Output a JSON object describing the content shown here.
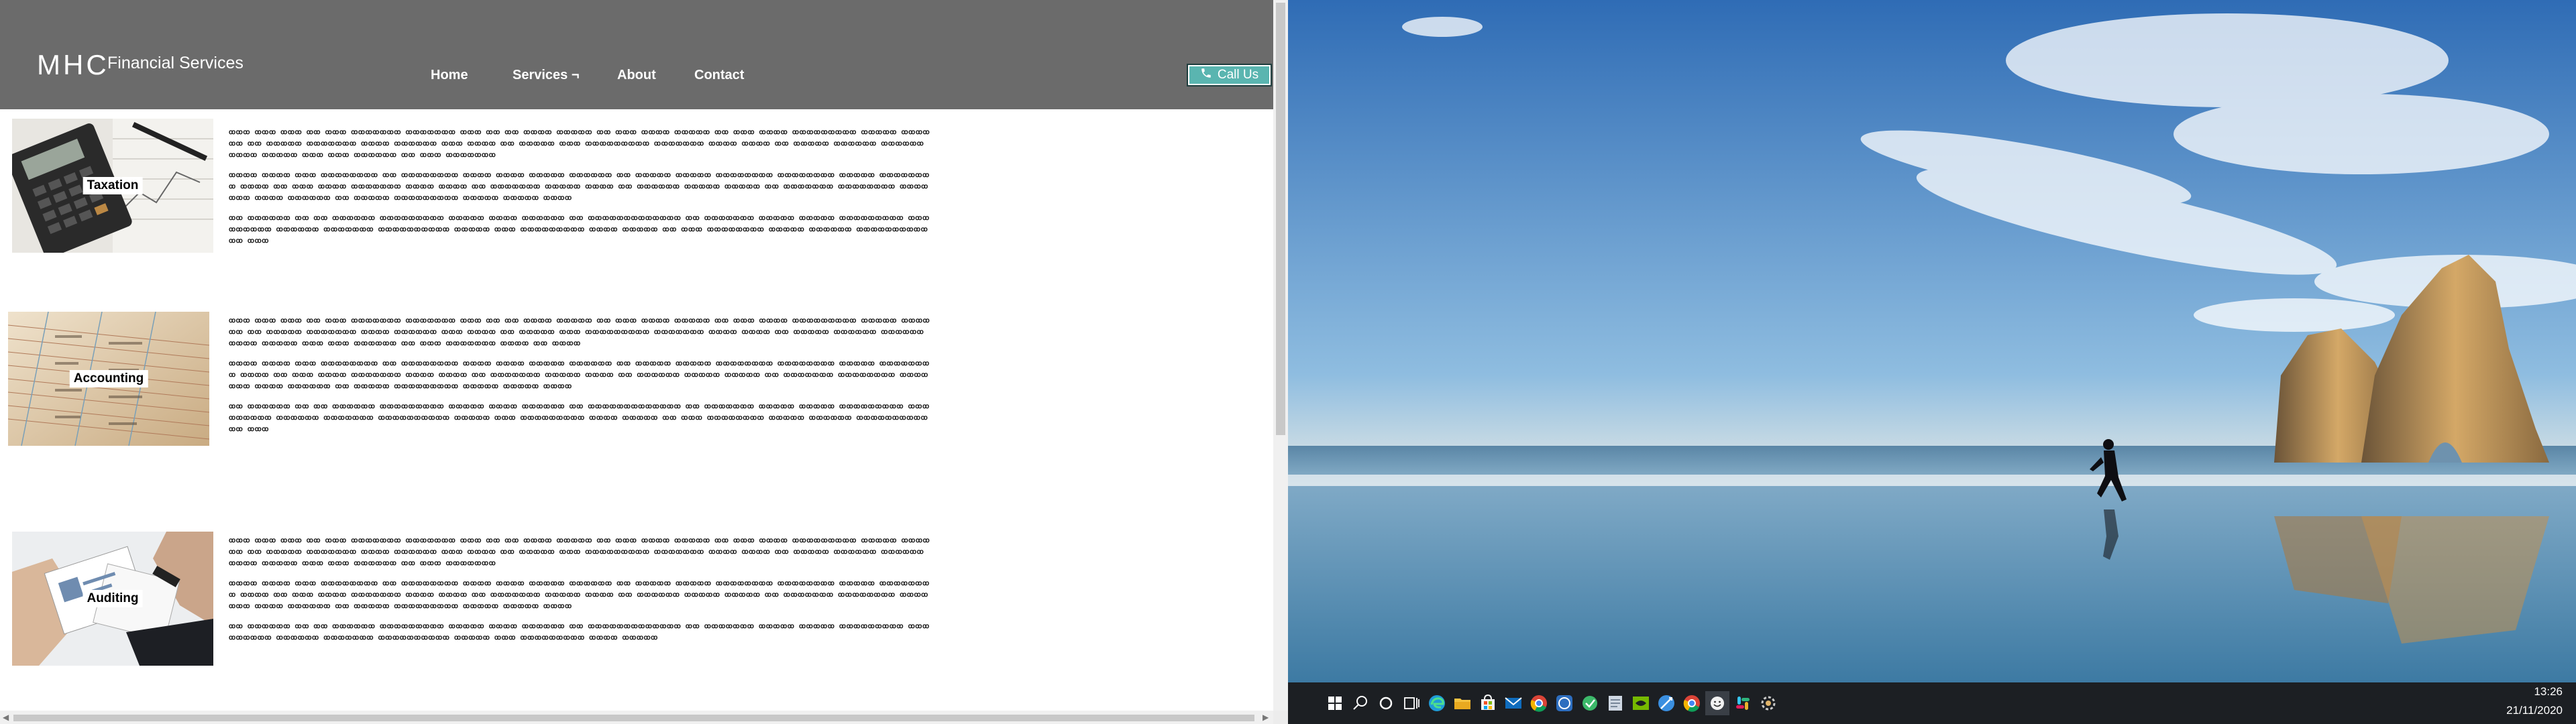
{
  "site": {
    "logo_mhc": "MHC",
    "logo_sub": "Financial Services",
    "nav": [
      "Home",
      "Services ¬",
      "About",
      "Contact"
    ],
    "call_label": "Call Us",
    "header_color": "#6b6b6b",
    "accent_color": "#5ab5b0"
  },
  "services": [
    {
      "label": "Taxation",
      "paragraphs": [
        "ꝏꝏꝏ ꝏꝏꝏ ꝏꝏꝏ ꝏꝏ ꝏꝏꝏ ꝏꝏꝏꝏꝏꝏꝏ ꝏꝏꝏꝏꝏꝏꝏ ꝏꝏꝏ ꝏꝏ ꝏꝏ ꝏꝏꝏꝏ ꝏꝏꝏꝏꝏ ꝏꝏ ꝏꝏꝏ ꝏꝏꝏꝏ ꝏꝏꝏꝏꝏ ꝏꝏ ꝏꝏꝏ ꝏꝏꝏꝏ ꝏꝏꝏꝏꝏꝏꝏꝏꝏ ꝏꝏꝏꝏꝏ ꝏꝏꝏꝏ ꝏꝏ ꝏꝏ ꝏꝏꝏꝏꝏ ꝏꝏꝏꝏꝏꝏꝏ ꝏꝏꝏꝏ ꝏꝏꝏꝏꝏꝏ ꝏꝏꝏ ꝏꝏꝏꝏ ꝏꝏ ꝏꝏꝏꝏꝏ ꝏꝏꝏ ꝏꝏꝏꝏꝏꝏꝏꝏꝏ ꝏꝏꝏꝏꝏꝏꝏ ꝏꝏꝏꝏ ꝏꝏꝏꝏ ꝏꝏ ꝏꝏꝏꝏꝏ ꝏꝏꝏꝏꝏꝏ ꝏꝏꝏꝏꝏꝏ ꝏꝏꝏꝏ ꝏꝏꝏꝏꝏ ꝏꝏꝏ ꝏꝏꝏ ꝏꝏꝏꝏꝏꝏ ꝏꝏ ꝏꝏꝏ ꝏꝏꝏꝏꝏꝏꝏ",
        "ꝏꝏꝏꝏ ꝏꝏꝏꝏ ꝏꝏꝏ ꝏꝏꝏꝏꝏꝏꝏꝏ ꝏꝏ ꝏꝏꝏꝏꝏꝏꝏꝏ ꝏꝏꝏꝏ ꝏꝏꝏꝏ ꝏꝏꝏꝏꝏ ꝏꝏꝏꝏꝏꝏ ꝏꝏ ꝏꝏꝏꝏꝏ ꝏꝏꝏꝏꝏ ꝏꝏꝏꝏꝏꝏꝏꝏ ꝏꝏꝏꝏꝏꝏꝏꝏ ꝏꝏꝏꝏꝏ ꝏꝏꝏꝏꝏꝏꝏꝏ ꝏꝏꝏꝏ ꝏꝏ ꝏꝏꝏ ꝏꝏꝏꝏ ꝏꝏꝏꝏꝏꝏꝏ ꝏꝏꝏꝏ ꝏꝏꝏꝏ ꝏꝏ ꝏꝏꝏꝏꝏꝏꝏ ꝏꝏꝏꝏꝏ ꝏꝏꝏꝏ ꝏꝏ ꝏꝏꝏꝏꝏꝏ ꝏꝏꝏꝏꝏ ꝏꝏꝏꝏꝏ ꝏꝏ ꝏꝏꝏꝏꝏꝏꝏ ꝏꝏꝏꝏꝏꝏꝏꝏ ꝏꝏꝏꝏꝏꝏꝏ ꝏꝏꝏꝏ ꝏꝏꝏꝏꝏꝏ ꝏꝏ ꝏꝏꝏꝏꝏ ꝏꝏꝏꝏꝏꝏꝏꝏꝏ ꝏꝏꝏꝏꝏ ꝏꝏꝏꝏꝏ ꝏꝏꝏꝏ",
        "ꝏꝏ ꝏꝏꝏꝏꝏꝏ ꝏꝏ ꝏꝏ ꝏꝏꝏꝏꝏꝏ ꝏꝏꝏꝏꝏꝏꝏꝏꝏ ꝏꝏꝏꝏꝏ ꝏꝏꝏꝏ ꝏꝏꝏꝏꝏꝏ ꝏꝏ ꝏꝏꝏꝏꝏꝏꝏꝏꝏꝏꝏꝏꝏ ꝏꝏ ꝏꝏꝏꝏꝏꝏꝏ ꝏꝏꝏꝏꝏ ꝏꝏꝏꝏꝏ ꝏꝏꝏꝏꝏꝏꝏꝏꝏ ꝏꝏꝏꝏꝏꝏꝏꝏꝏ ꝏꝏꝏꝏꝏꝏ ꝏꝏꝏꝏꝏꝏꝏ ꝏꝏꝏꝏꝏꝏꝏꝏꝏꝏ ꝏꝏꝏꝏꝏ ꝏꝏꝏ ꝏꝏꝏꝏꝏꝏꝏꝏꝏ ꝏꝏꝏꝏ ꝏꝏꝏꝏꝏ ꝏꝏ ꝏꝏꝏ ꝏꝏꝏꝏꝏꝏꝏꝏ ꝏꝏꝏꝏꝏ ꝏꝏꝏꝏꝏꝏ ꝏꝏꝏꝏꝏꝏꝏꝏꝏꝏꝏꝏ ꝏꝏꝏ"
      ]
    },
    {
      "label": "Accounting",
      "paragraphs": [
        "ꝏꝏꝏ ꝏꝏꝏ ꝏꝏꝏ ꝏꝏ ꝏꝏꝏ ꝏꝏꝏꝏꝏꝏꝏ ꝏꝏꝏꝏꝏꝏꝏ ꝏꝏꝏ ꝏꝏ ꝏꝏ ꝏꝏꝏꝏ ꝏꝏꝏꝏꝏ ꝏꝏ ꝏꝏꝏ ꝏꝏꝏꝏ ꝏꝏꝏꝏꝏ ꝏꝏ ꝏꝏꝏ ꝏꝏꝏꝏ ꝏꝏꝏꝏꝏꝏꝏꝏꝏ ꝏꝏꝏꝏꝏ ꝏꝏꝏꝏ ꝏꝏ ꝏꝏ ꝏꝏꝏꝏꝏ ꝏꝏꝏꝏꝏꝏꝏ ꝏꝏꝏꝏ ꝏꝏꝏꝏꝏꝏ ꝏꝏꝏ ꝏꝏꝏꝏ ꝏꝏ ꝏꝏꝏꝏꝏ ꝏꝏꝏ ꝏꝏꝏꝏꝏꝏꝏꝏꝏ ꝏꝏꝏꝏꝏꝏꝏ ꝏꝏꝏꝏ ꝏꝏꝏꝏ ꝏꝏ ꝏꝏꝏꝏꝏ ꝏꝏꝏꝏꝏꝏ ꝏꝏꝏꝏꝏꝏ ꝏꝏꝏꝏ ꝏꝏꝏꝏꝏ ꝏꝏꝏ ꝏꝏꝏ ꝏꝏꝏꝏꝏꝏ ꝏꝏ ꝏꝏꝏ ꝏꝏꝏꝏꝏꝏꝏ ꝏꝏꝏꝏ ꝏꝏ ꝏꝏꝏꝏ",
        "ꝏꝏꝏꝏ ꝏꝏꝏꝏ ꝏꝏꝏ ꝏꝏꝏꝏꝏꝏꝏꝏ ꝏꝏ ꝏꝏꝏꝏꝏꝏꝏꝏ ꝏꝏꝏꝏ ꝏꝏꝏꝏ ꝏꝏꝏꝏꝏ ꝏꝏꝏꝏꝏꝏ ꝏꝏ ꝏꝏꝏꝏꝏ ꝏꝏꝏꝏꝏ ꝏꝏꝏꝏꝏꝏꝏꝏ ꝏꝏꝏꝏꝏꝏꝏꝏ ꝏꝏꝏꝏꝏ ꝏꝏꝏꝏꝏꝏꝏꝏ ꝏꝏꝏꝏ ꝏꝏ ꝏꝏꝏ ꝏꝏꝏꝏ ꝏꝏꝏꝏꝏꝏꝏ ꝏꝏꝏꝏ ꝏꝏꝏꝏ ꝏꝏ ꝏꝏꝏꝏꝏꝏꝏ ꝏꝏꝏꝏꝏ ꝏꝏꝏꝏ ꝏꝏ ꝏꝏꝏꝏꝏꝏ ꝏꝏꝏꝏꝏ ꝏꝏꝏꝏꝏ ꝏꝏ ꝏꝏꝏꝏꝏꝏꝏ ꝏꝏꝏꝏꝏꝏꝏꝏ ꝏꝏꝏꝏꝏꝏꝏ ꝏꝏꝏꝏ ꝏꝏꝏꝏꝏꝏ ꝏꝏ ꝏꝏꝏꝏꝏ ꝏꝏꝏꝏꝏꝏꝏꝏꝏ ꝏꝏꝏꝏꝏ ꝏꝏꝏꝏꝏ ꝏꝏꝏꝏ",
        "ꝏꝏ ꝏꝏꝏꝏꝏꝏ ꝏꝏ ꝏꝏ ꝏꝏꝏꝏꝏꝏ ꝏꝏꝏꝏꝏꝏꝏꝏꝏ ꝏꝏꝏꝏꝏ ꝏꝏꝏꝏ ꝏꝏꝏꝏꝏꝏ ꝏꝏ ꝏꝏꝏꝏꝏꝏꝏꝏꝏꝏꝏꝏꝏ ꝏꝏ ꝏꝏꝏꝏꝏꝏꝏ ꝏꝏꝏꝏꝏ ꝏꝏꝏꝏꝏ ꝏꝏꝏꝏꝏꝏꝏꝏꝏ ꝏꝏꝏꝏꝏꝏꝏꝏꝏ ꝏꝏꝏꝏꝏꝏ ꝏꝏꝏꝏꝏꝏꝏ ꝏꝏꝏꝏꝏꝏꝏꝏꝏꝏ ꝏꝏꝏꝏꝏ ꝏꝏꝏ ꝏꝏꝏꝏꝏꝏꝏꝏꝏ ꝏꝏꝏꝏ ꝏꝏꝏꝏꝏ ꝏꝏ ꝏꝏꝏ ꝏꝏꝏꝏꝏꝏꝏꝏ ꝏꝏꝏꝏꝏ ꝏꝏꝏꝏꝏꝏ ꝏꝏꝏꝏꝏꝏꝏꝏꝏꝏꝏꝏ ꝏꝏꝏ"
      ]
    },
    {
      "label": "Auditing",
      "paragraphs": [
        "ꝏꝏꝏ ꝏꝏꝏ ꝏꝏꝏ ꝏꝏ ꝏꝏꝏ ꝏꝏꝏꝏꝏꝏꝏ ꝏꝏꝏꝏꝏꝏꝏ ꝏꝏꝏ ꝏꝏ ꝏꝏ ꝏꝏꝏꝏ ꝏꝏꝏꝏꝏ ꝏꝏ ꝏꝏꝏ ꝏꝏꝏꝏ ꝏꝏꝏꝏꝏ ꝏꝏ ꝏꝏꝏ ꝏꝏꝏꝏ ꝏꝏꝏꝏꝏꝏꝏꝏꝏ ꝏꝏꝏꝏꝏ ꝏꝏꝏꝏ ꝏꝏ ꝏꝏ ꝏꝏꝏꝏꝏ ꝏꝏꝏꝏꝏꝏꝏ ꝏꝏꝏꝏ ꝏꝏꝏꝏꝏꝏ ꝏꝏꝏ ꝏꝏꝏꝏ ꝏꝏ ꝏꝏꝏꝏꝏ ꝏꝏꝏ ꝏꝏꝏꝏꝏꝏꝏꝏꝏ ꝏꝏꝏꝏꝏꝏꝏ ꝏꝏꝏꝏ ꝏꝏꝏꝏ ꝏꝏ ꝏꝏꝏꝏꝏ ꝏꝏꝏꝏꝏꝏ ꝏꝏꝏꝏꝏꝏ ꝏꝏꝏꝏ ꝏꝏꝏꝏꝏ ꝏꝏꝏ ꝏꝏꝏ ꝏꝏꝏꝏꝏꝏ ꝏꝏ ꝏꝏꝏ ꝏꝏꝏꝏꝏꝏꝏ",
        "ꝏꝏꝏꝏ ꝏꝏꝏꝏ ꝏꝏꝏ ꝏꝏꝏꝏꝏꝏꝏꝏ ꝏꝏ ꝏꝏꝏꝏꝏꝏꝏꝏ ꝏꝏꝏꝏ ꝏꝏꝏꝏ ꝏꝏꝏꝏꝏ ꝏꝏꝏꝏꝏꝏ ꝏꝏ ꝏꝏꝏꝏꝏ ꝏꝏꝏꝏꝏ ꝏꝏꝏꝏꝏꝏꝏꝏ ꝏꝏꝏꝏꝏꝏꝏꝏ ꝏꝏꝏꝏꝏ ꝏꝏꝏꝏꝏꝏꝏꝏ ꝏꝏꝏꝏ ꝏꝏ ꝏꝏꝏ ꝏꝏꝏꝏ ꝏꝏꝏꝏꝏꝏꝏ ꝏꝏꝏꝏ ꝏꝏꝏꝏ ꝏꝏ ꝏꝏꝏꝏꝏꝏꝏ ꝏꝏꝏꝏꝏ ꝏꝏꝏꝏ ꝏꝏ ꝏꝏꝏꝏꝏꝏ ꝏꝏꝏꝏꝏ ꝏꝏꝏꝏꝏ ꝏꝏ ꝏꝏꝏꝏꝏꝏꝏ ꝏꝏꝏꝏꝏꝏꝏꝏ ꝏꝏꝏꝏꝏꝏꝏ ꝏꝏꝏꝏ ꝏꝏꝏꝏꝏꝏ ꝏꝏ ꝏꝏꝏꝏꝏ ꝏꝏꝏꝏꝏꝏꝏꝏꝏ ꝏꝏꝏꝏꝏ ꝏꝏꝏꝏꝏ ꝏꝏꝏꝏ",
        "ꝏꝏ ꝏꝏꝏꝏꝏꝏ ꝏꝏ ꝏꝏ ꝏꝏꝏꝏꝏꝏ ꝏꝏꝏꝏꝏꝏꝏꝏꝏ ꝏꝏꝏꝏꝏ ꝏꝏꝏꝏ ꝏꝏꝏꝏꝏꝏ ꝏꝏ ꝏꝏꝏꝏꝏꝏꝏꝏꝏꝏꝏꝏꝏ ꝏꝏ ꝏꝏꝏꝏꝏꝏꝏ ꝏꝏꝏꝏꝏ ꝏꝏꝏꝏꝏ ꝏꝏꝏꝏꝏꝏꝏꝏꝏ ꝏꝏꝏꝏꝏꝏꝏꝏꝏ ꝏꝏꝏꝏꝏꝏ ꝏꝏꝏꝏꝏꝏꝏ ꝏꝏꝏꝏꝏꝏꝏꝏꝏꝏ ꝏꝏꝏꝏꝏ ꝏꝏꝏ ꝏꝏꝏꝏꝏꝏꝏꝏꝏ ꝏꝏꝏꝏ ꝏꝏꝏꝏꝏ"
      ]
    }
  ],
  "taskbar": {
    "icons": [
      "windows-start-icon",
      "search-icon",
      "cortana-icon",
      "task-view-icon",
      "edge-icon",
      "file-explorer-icon",
      "store-icon",
      "mail-icon",
      "chrome-icon",
      "whatsapp-icon",
      "app-green-icon",
      "notepad-icon",
      "nvidia-icon",
      "browser-blue-icon",
      "chrome-alt-icon",
      "smiley-app-icon",
      "slack-icon",
      "settings-app-icon"
    ],
    "time": "13:26",
    "date": "21/11/2020",
    "background": "#1c1f23"
  }
}
